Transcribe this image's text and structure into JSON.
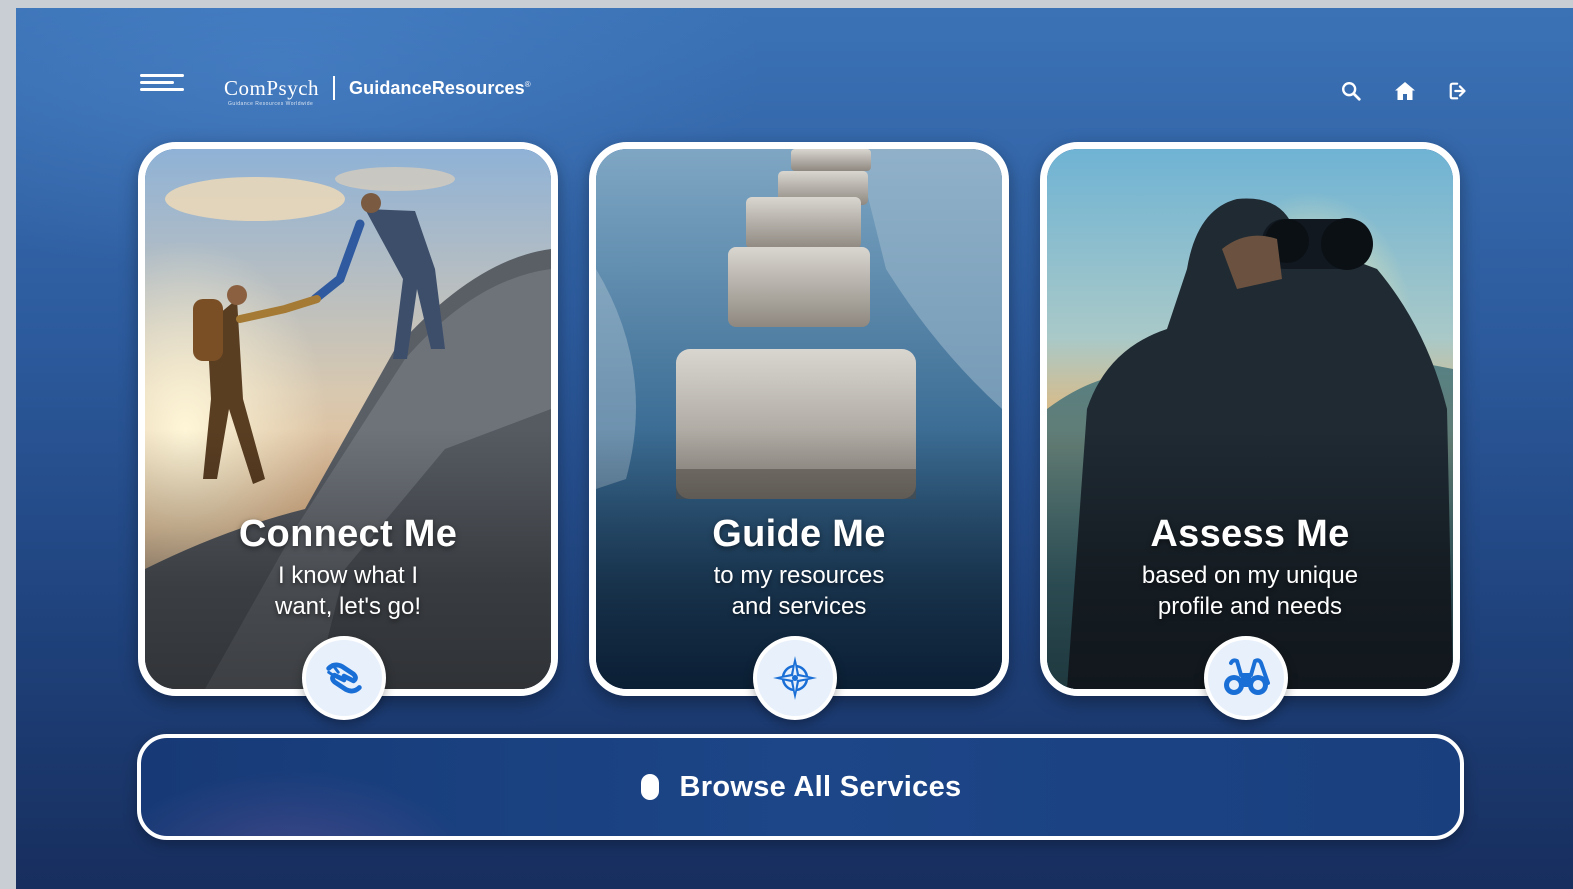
{
  "header": {
    "brand_primary": "ComPsych",
    "brand_tagline": "Guidance Resources Worldwide",
    "brand_secondary": "GuidanceResources",
    "brand_mark": "®"
  },
  "top_icons": [
    "search-icon",
    "home-icon",
    "logout-icon"
  ],
  "cards": [
    {
      "title": "Connect Me",
      "subtitle": "I know what I\nwant, let's go!",
      "icon": "helping-hands-icon"
    },
    {
      "title": "Guide Me",
      "subtitle": "to my resources\nand services",
      "icon": "compass-icon"
    },
    {
      "title": "Assess Me",
      "subtitle": "based on my unique\nprofile and needs",
      "icon": "binoculars-icon"
    }
  ],
  "browse": {
    "label": "Browse All Services",
    "icon": "pill-icon"
  },
  "colors": {
    "accent_blue": "#1a6fd6",
    "badge_bg": "#e8f0fb",
    "panel_dark": "#173a76"
  }
}
